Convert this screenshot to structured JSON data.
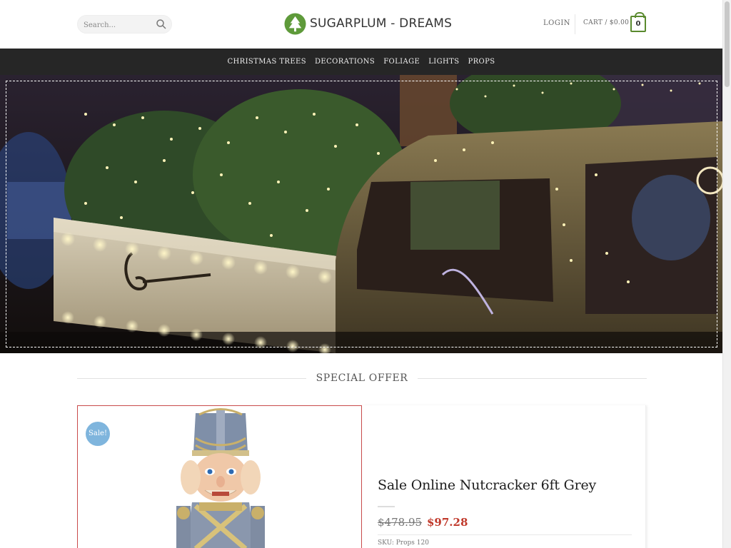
{
  "header": {
    "search_placeholder": "Search...",
    "logo_text": "SUGARPLUM - DREAMS",
    "login_label": "LOGIN",
    "cart_label": "CART / $0.00",
    "cart_count": "0"
  },
  "nav": {
    "items": [
      "CHRISTMAS TREES",
      "DECORATIONS",
      "FOLIAGE",
      "LIGHTS",
      "PROPS"
    ]
  },
  "special_offer": {
    "heading": "SPECIAL OFFER"
  },
  "product": {
    "badge": "Sale!",
    "title": "Sale Online Nutcracker 6ft Grey",
    "old_price": "$478.95",
    "new_price": "$97.28",
    "sku": "SKU: Props 120"
  },
  "colors": {
    "nav_bg": "#262626",
    "accent_green": "#5a8a2e",
    "sale_red": "#c0392b",
    "badge_blue": "#7fb5dd"
  },
  "icons": {
    "search": "search-icon",
    "logo": "tree-logo-icon",
    "cart": "cart-bag-icon"
  }
}
